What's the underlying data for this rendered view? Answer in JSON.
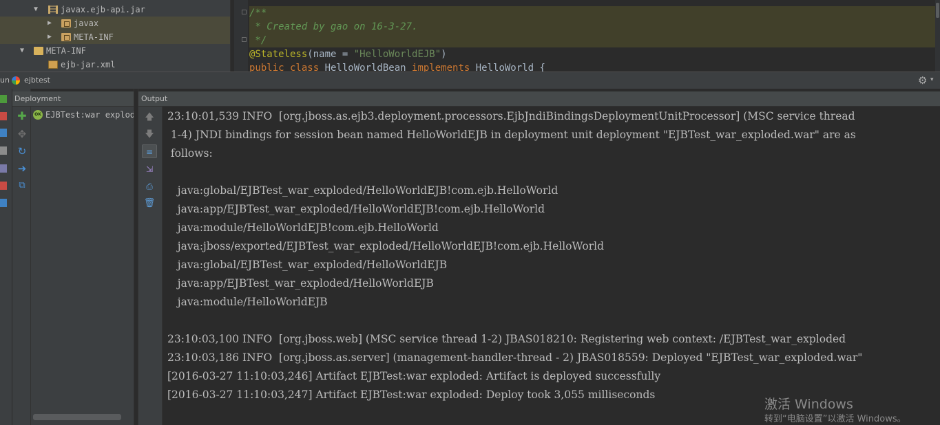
{
  "project_tree": {
    "items": [
      {
        "label": "javax.ejb-api.jar",
        "arrow": "▼"
      },
      {
        "label": "javax",
        "arrow": "▶"
      },
      {
        "label": "META-INF",
        "arrow": "▶"
      },
      {
        "label": "META-INF",
        "arrow": "▼"
      },
      {
        "label": "ejb-jar.xml",
        "arrow": ""
      }
    ]
  },
  "editor": {
    "line1": "/**",
    "line2": " * Created by gao on 16-3-27.",
    "line3": " */",
    "line4": {
      "annotation": "@Stateless",
      "open": "(name = ",
      "string": "\"HelloWorldEJB\"",
      "close": ")"
    },
    "line5": {
      "kw1": "public class ",
      "name": "HelloWorldBean ",
      "kw2": "implements ",
      "iface": "HelloWorld {"
    }
  },
  "run_window": {
    "run_label": "un",
    "tab_label": "ejbtest"
  },
  "deployment": {
    "header": "Deployment",
    "status_icon_text": "OK",
    "item_label": "EJBTest:war exploded"
  },
  "output": {
    "header": "Output",
    "lines": [
      "23:10:01,539 INFO  [org.jboss.as.ejb3.deployment.processors.EjbJndiBindingsDeploymentUnitProcessor] (MSC service thread",
      " 1-4) JNDI bindings for session bean named HelloWorldEJB in deployment unit deployment \"EJBTest_war_exploded.war\" are as",
      " follows:",
      "",
      "   java:global/EJBTest_war_exploded/HelloWorldEJB!com.ejb.HelloWorld",
      "   java:app/EJBTest_war_exploded/HelloWorldEJB!com.ejb.HelloWorld",
      "   java:module/HelloWorldEJB!com.ejb.HelloWorld",
      "   java:jboss/exported/EJBTest_war_exploded/HelloWorldEJB!com.ejb.HelloWorld",
      "   java:global/EJBTest_war_exploded/HelloWorldEJB",
      "   java:app/EJBTest_war_exploded/HelloWorldEJB",
      "   java:module/HelloWorldEJB",
      "",
      "23:10:03,100 INFO  [org.jboss.web] (MSC service thread 1-2) JBAS018210: Registering web context: /EJBTest_war_exploded",
      "23:10:03,186 INFO  [org.jboss.as.server] (management-handler-thread - 2) JBAS018559: Deployed \"EJBTest_war_exploded.war\"",
      "[2016-03-27 11:10:03,246] Artifact EJBTest:war exploded: Artifact is deployed successfully",
      "[2016-03-27 11:10:03,247] Artifact EJBTest:war exploded: Deploy took 3,055 milliseconds"
    ]
  },
  "watermark": {
    "title": "激活 Windows",
    "subtitle": "转到“电脑设置”以激活 Windows。"
  },
  "colors": {
    "background": "#2b2b2b",
    "panel": "#3c3f41",
    "doc_comment": "#629755",
    "annotation": "#bbb529",
    "keyword": "#cc7832",
    "string": "#6a8759",
    "ok_green": "#8bb548"
  }
}
